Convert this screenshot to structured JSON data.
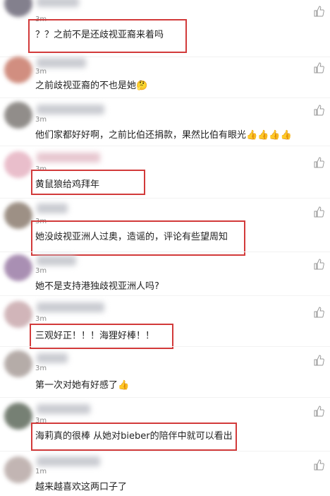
{
  "comments": [
    {
      "time": "3m",
      "text": "？？之前不是还歧视亚裔来着吗",
      "emoji": ""
    },
    {
      "time": "3m",
      "text": "之前歧视亚裔的不也是她",
      "emoji": "🤔"
    },
    {
      "time": "3m",
      "text": "他们家都好好啊，之前比伯还捐款，果然比伯有眼光",
      "emoji": "👍👍👍👍"
    },
    {
      "time": "3m",
      "text": "黄鼠狼给鸡拜年",
      "emoji": ""
    },
    {
      "time": "3m",
      "text": "她没歧视亚洲人过奥，造谣的，评论有些望周知",
      "emoji": ""
    },
    {
      "time": "3m",
      "text": "她不是支持港独歧视亚洲人吗?",
      "emoji": ""
    },
    {
      "time": "3m",
      "text": "三观好正！！！海狸好棒！！",
      "emoji": ""
    },
    {
      "time": "3m",
      "text": "第一次对她有好感了",
      "emoji": "👍"
    },
    {
      "time": "3m",
      "text": "海莉真的很棒 从她对bieber的陪伴中就可以看出",
      "emoji": ""
    },
    {
      "time": "1m",
      "text": "越来越喜欢这两口子了",
      "emoji": ""
    }
  ],
  "icons": {
    "like": "thumbs-up-icon"
  },
  "colors": {
    "highlight": "#d23a3a",
    "time": "#8a8a8a"
  }
}
